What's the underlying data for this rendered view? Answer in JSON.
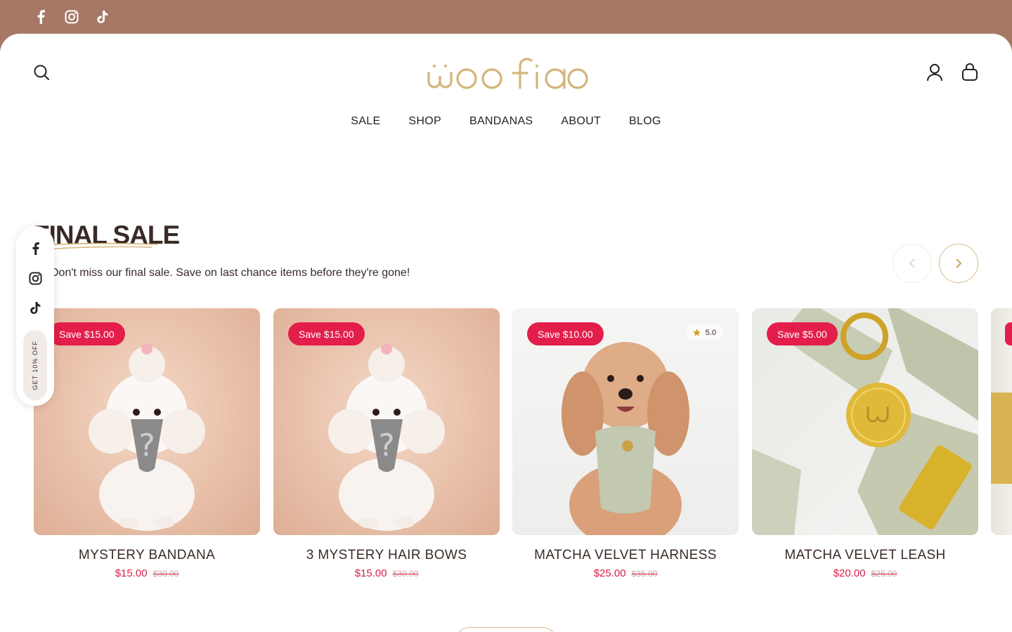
{
  "brand": {
    "name": "woofiao",
    "accent": "#d4b47a",
    "topbar_color": "#a57966",
    "sale_color": "#e31e4b"
  },
  "topbar": {
    "social": [
      "facebook-icon",
      "instagram-icon",
      "tiktok-icon"
    ]
  },
  "nav": {
    "items": [
      "SALE",
      "SHOP",
      "BANDANAS",
      "ABOUT",
      "BLOG"
    ]
  },
  "section": {
    "title": "FINAL SALE",
    "subtitle": "Don't miss our final sale. Save on last chance items before they're gone!"
  },
  "floating_panel": {
    "icons": [
      "facebook-icon",
      "instagram-icon",
      "tiktok-icon"
    ],
    "promo_label": "GET 10% OFF"
  },
  "products": [
    {
      "badge": "Save $15.00",
      "name": "MYSTERY BANDANA",
      "price": "$15.00",
      "old_price": "$30.00",
      "rating": ""
    },
    {
      "badge": "Save $15.00",
      "name": "3 MYSTERY HAIR BOWS",
      "price": "$15.00",
      "old_price": "$30.00",
      "rating": ""
    },
    {
      "badge": "Save $10.00",
      "name": "MATCHA VELVET HARNESS",
      "price": "$25.00",
      "old_price": "$35.00",
      "rating": "5.0"
    },
    {
      "badge": "Save $5.00",
      "name": "MATCHA VELVET LEASH",
      "price": "$20.00",
      "old_price": "$25.00",
      "rating": ""
    }
  ]
}
